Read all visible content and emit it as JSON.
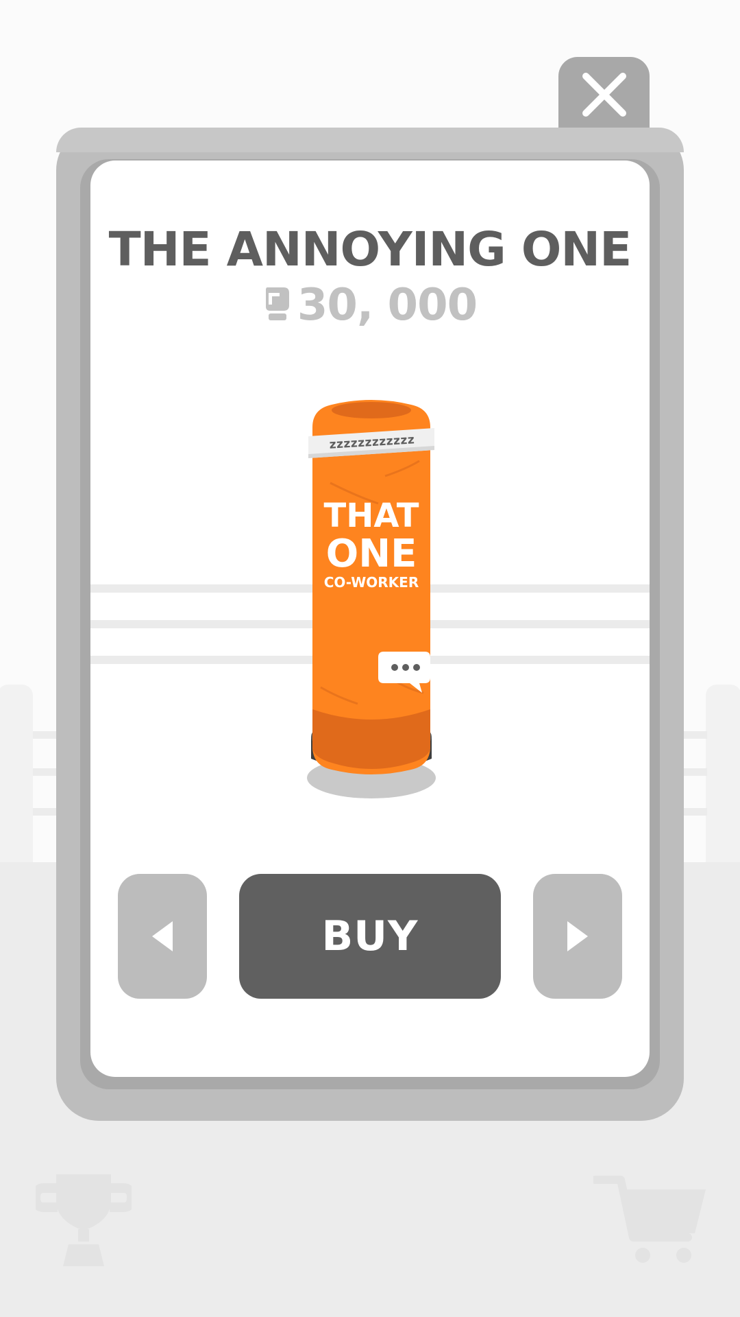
{
  "modal": {
    "title": "THE ANNOYING ONE",
    "price": "30, 000",
    "currency_icon": "glove-icon",
    "item": {
      "top_band": "zzzzzzzzzzzz",
      "line1": "THAT",
      "line2": "ONE",
      "line3": "CO-WORKER",
      "speech_icon": "speech-bubble-icon"
    },
    "buy_label": "BUY",
    "prev_icon": "arrow-left-icon",
    "next_icon": "arrow-right-icon",
    "close_icon": "close-icon"
  },
  "background": {
    "left_icon": "trophy-icon",
    "right_icon": "cart-icon"
  },
  "colors": {
    "bag_orange": "#fe841f",
    "bag_dark": "#e06a1b",
    "buy_button": "#606060",
    "nav_button": "#bcbcbc",
    "frame": "#bdbdbd",
    "title": "#5e5e5e",
    "price": "#c1c1c1"
  }
}
